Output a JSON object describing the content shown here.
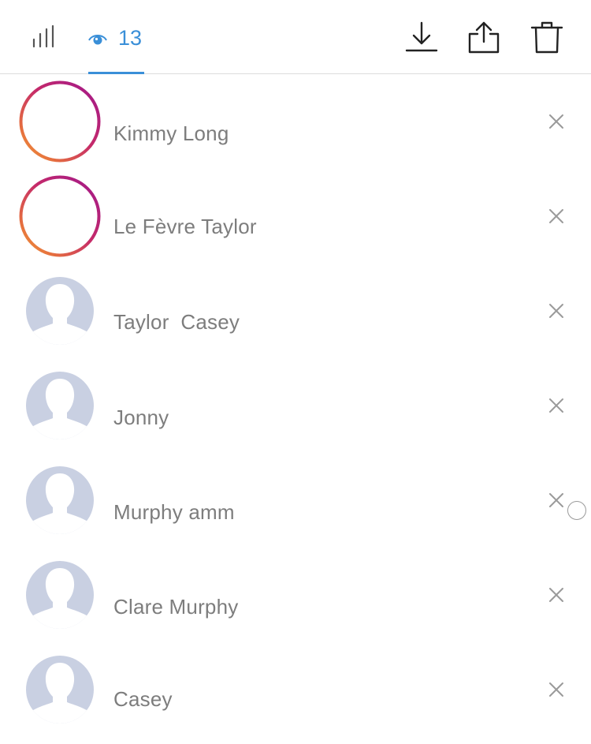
{
  "header": {
    "stats_icon": "bar-chart-icon",
    "viewers_icon": "eye-icon",
    "viewer_count": "13",
    "actions": [
      "download-icon",
      "share-icon",
      "trash-icon"
    ],
    "accent_color": "#3a8fd8"
  },
  "viewers": [
    {
      "name": "Kimmy Long",
      "avatar": "story-ring"
    },
    {
      "name": "Le Fèvre Taylor",
      "avatar": "story-ring"
    },
    {
      "name": "Taylor  Casey",
      "avatar": "default-silhouette"
    },
    {
      "name": "Jonny",
      "avatar": "default-silhouette"
    },
    {
      "name": "Murphy amm",
      "avatar": "default-silhouette"
    },
    {
      "name": "Clare Murphy",
      "avatar": "default-silhouette"
    },
    {
      "name": "Casey",
      "avatar": "default-silhouette"
    }
  ],
  "row_action_icon": "close-icon",
  "colors": {
    "ring_start": "#b0218f",
    "ring_end": "#f0a030",
    "silhouette_bg": "#c9d0e2",
    "name_text": "#7d7d7d"
  }
}
